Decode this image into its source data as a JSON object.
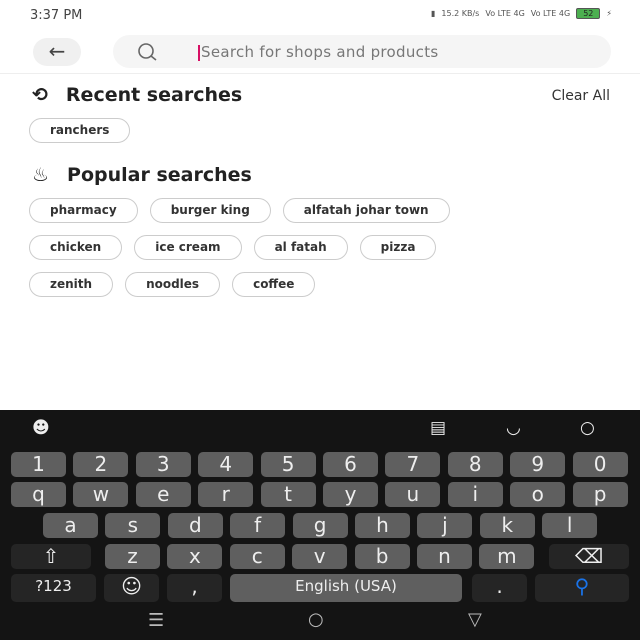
{
  "status": {
    "time": "3:37 PM",
    "net": "15.2 KB/s",
    "sim1": "Vo LTE 4G",
    "sim2": "Vo LTE 4G",
    "battery": "52"
  },
  "search": {
    "placeholder": "Search for shops and products"
  },
  "recent": {
    "title": "Recent searches",
    "clear": "Clear All",
    "items": [
      "ranchers"
    ]
  },
  "popular": {
    "title": "Popular searches",
    "rows": [
      [
        "pharmacy",
        "burger king",
        "alfatah johar town"
      ],
      [
        "chicken",
        "ice cream",
        "al fatah",
        "pizza"
      ],
      [
        "zenith",
        "noodles",
        "coffee"
      ]
    ]
  },
  "keyboard": {
    "numbers": [
      "1",
      "2",
      "3",
      "4",
      "5",
      "6",
      "7",
      "8",
      "9",
      "0"
    ],
    "row1": [
      "q",
      "w",
      "e",
      "r",
      "t",
      "y",
      "u",
      "i",
      "o",
      "p"
    ],
    "row2": [
      "a",
      "s",
      "d",
      "f",
      "g",
      "h",
      "j",
      "k",
      "l"
    ],
    "row3": [
      "z",
      "x",
      "c",
      "v",
      "b",
      "n",
      "m"
    ],
    "sym": "?123",
    "comma": ",",
    "space": "English (USA)",
    "period": ".",
    "accent": "#1a73e8"
  }
}
